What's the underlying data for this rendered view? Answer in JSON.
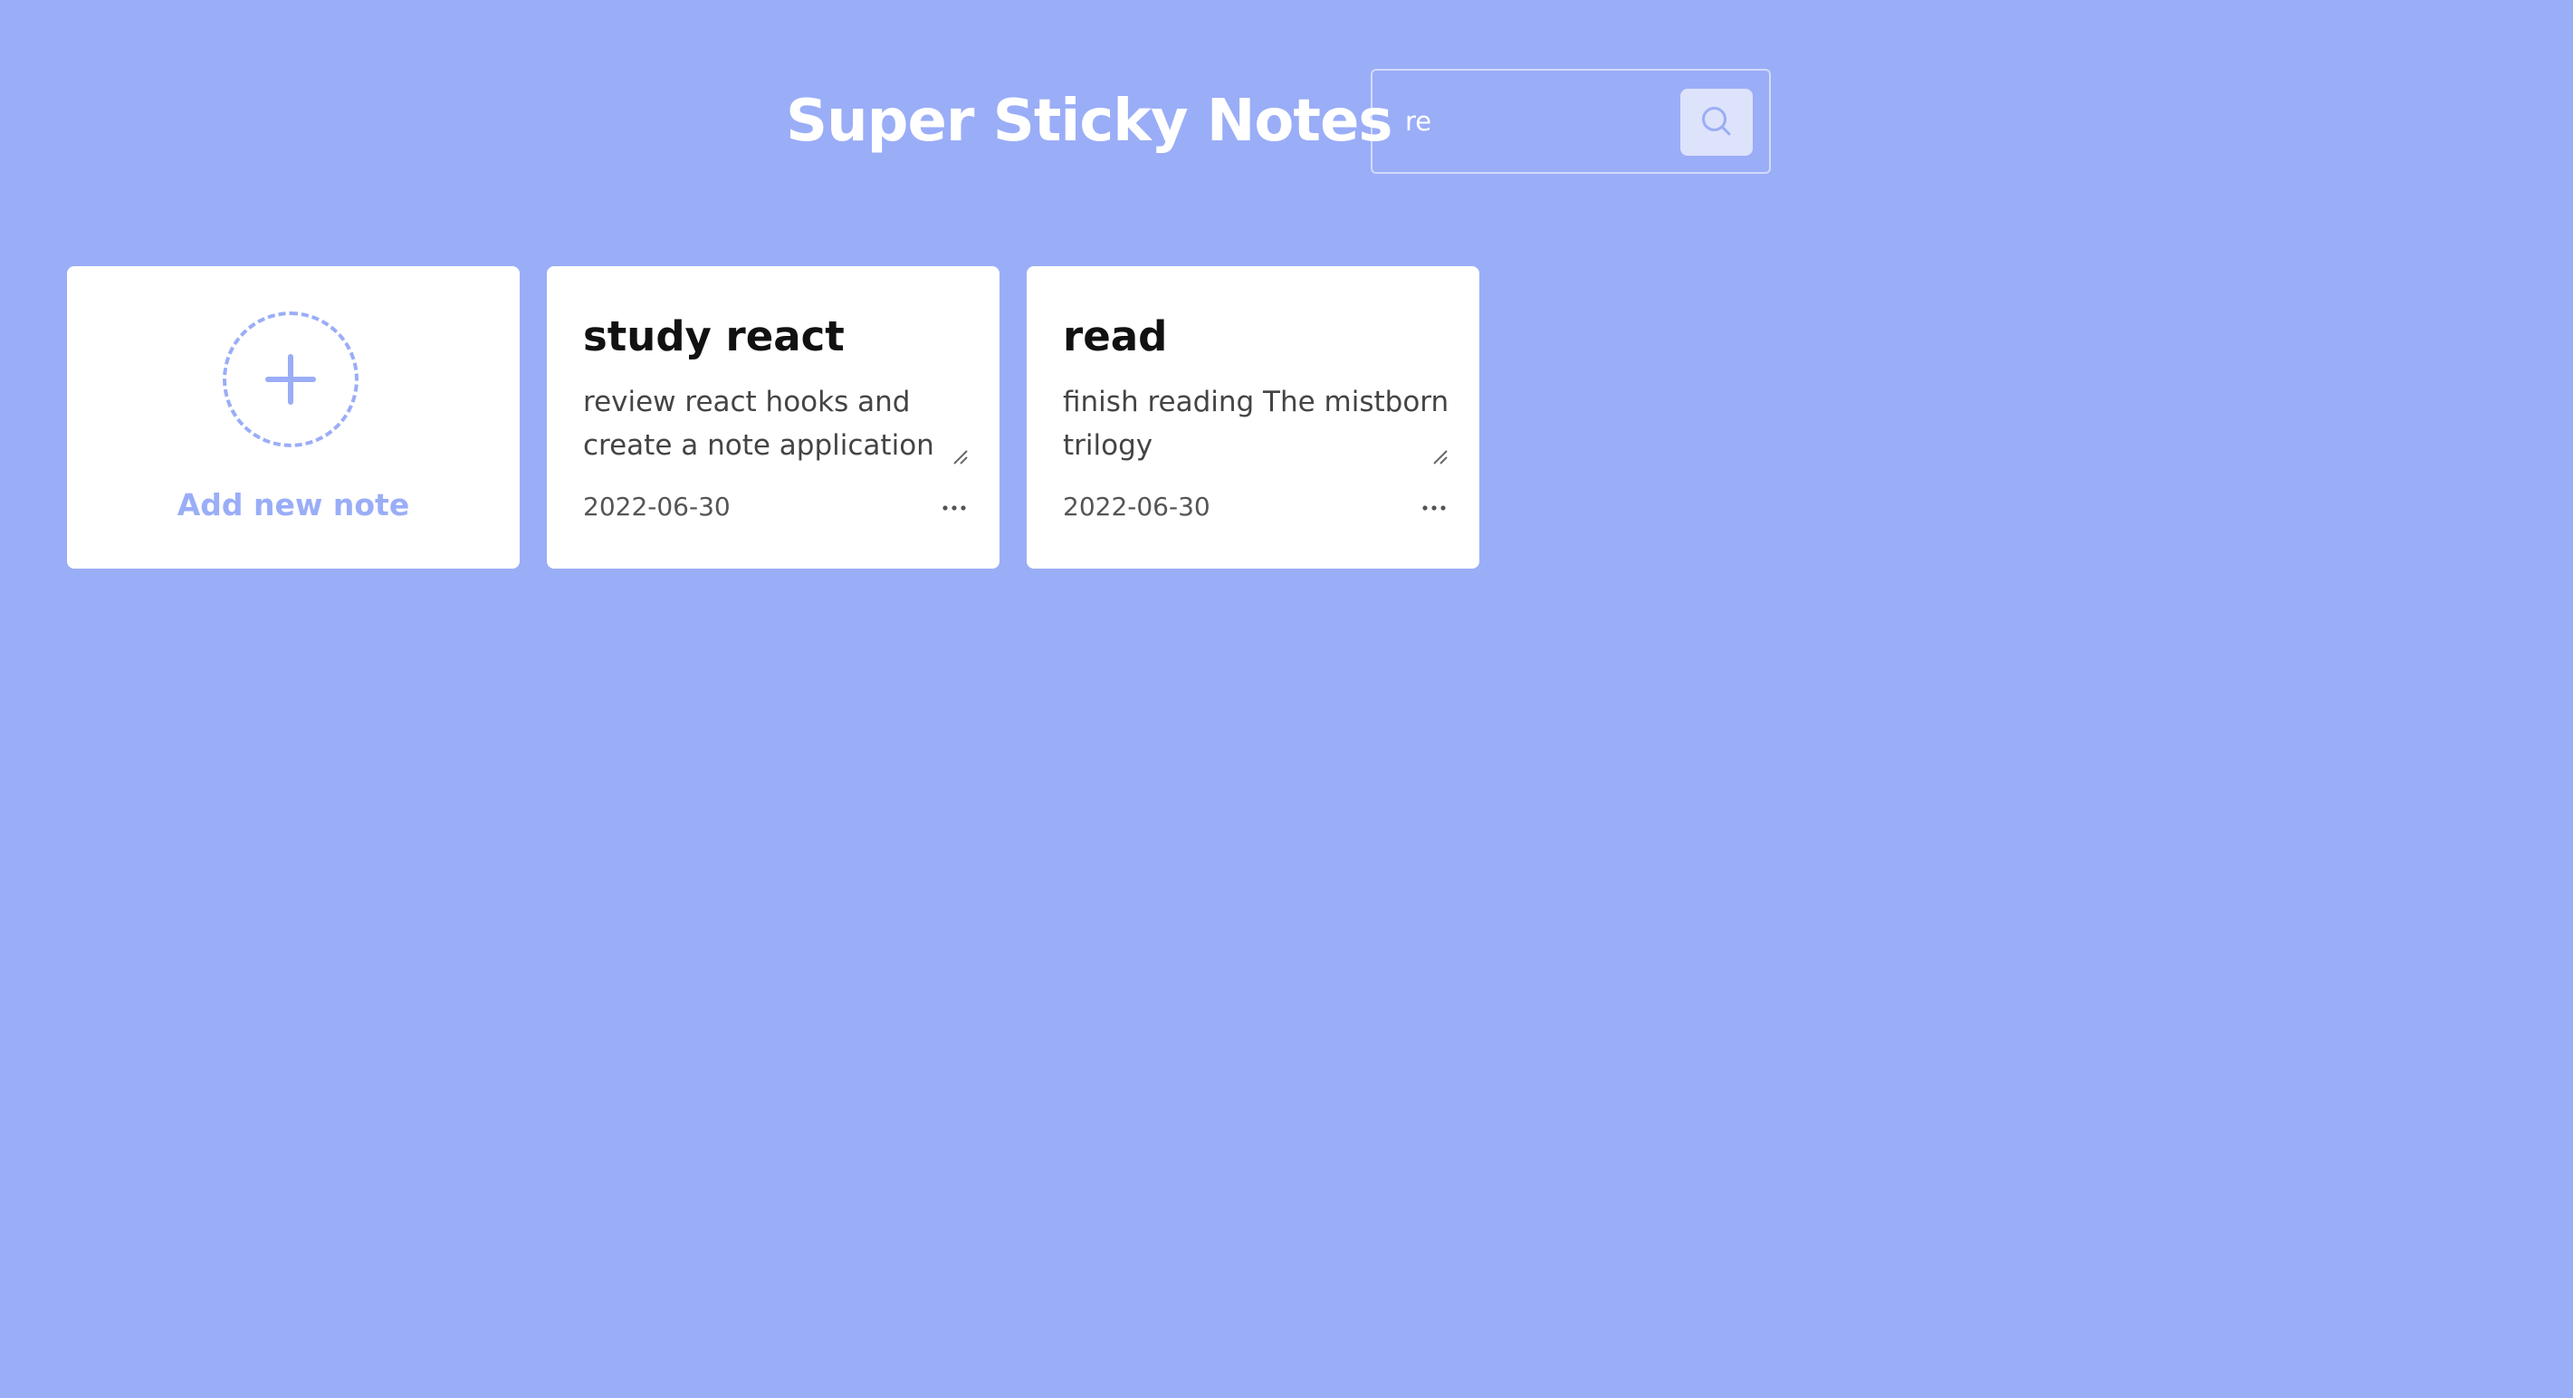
{
  "app": {
    "title": "Super Sticky Notes"
  },
  "search": {
    "value": "re",
    "placeholder": "",
    "button_icon": "search-icon"
  },
  "add_card": {
    "icon": "plus-icon",
    "label": "Add new note"
  },
  "notes": [
    {
      "title": "study react",
      "body": "review react hooks and create a note application",
      "date": "2022-06-30",
      "menu_icon": "more-horizontal-icon"
    },
    {
      "title": "read",
      "body": "finish reading The mistborn trilogy",
      "date": "2022-06-30",
      "menu_icon": "more-horizontal-icon"
    }
  ],
  "colors": {
    "background": "#9aadf7",
    "card": "#ffffff",
    "accent": "#9aadf7",
    "search_button": "#dde3fb"
  }
}
